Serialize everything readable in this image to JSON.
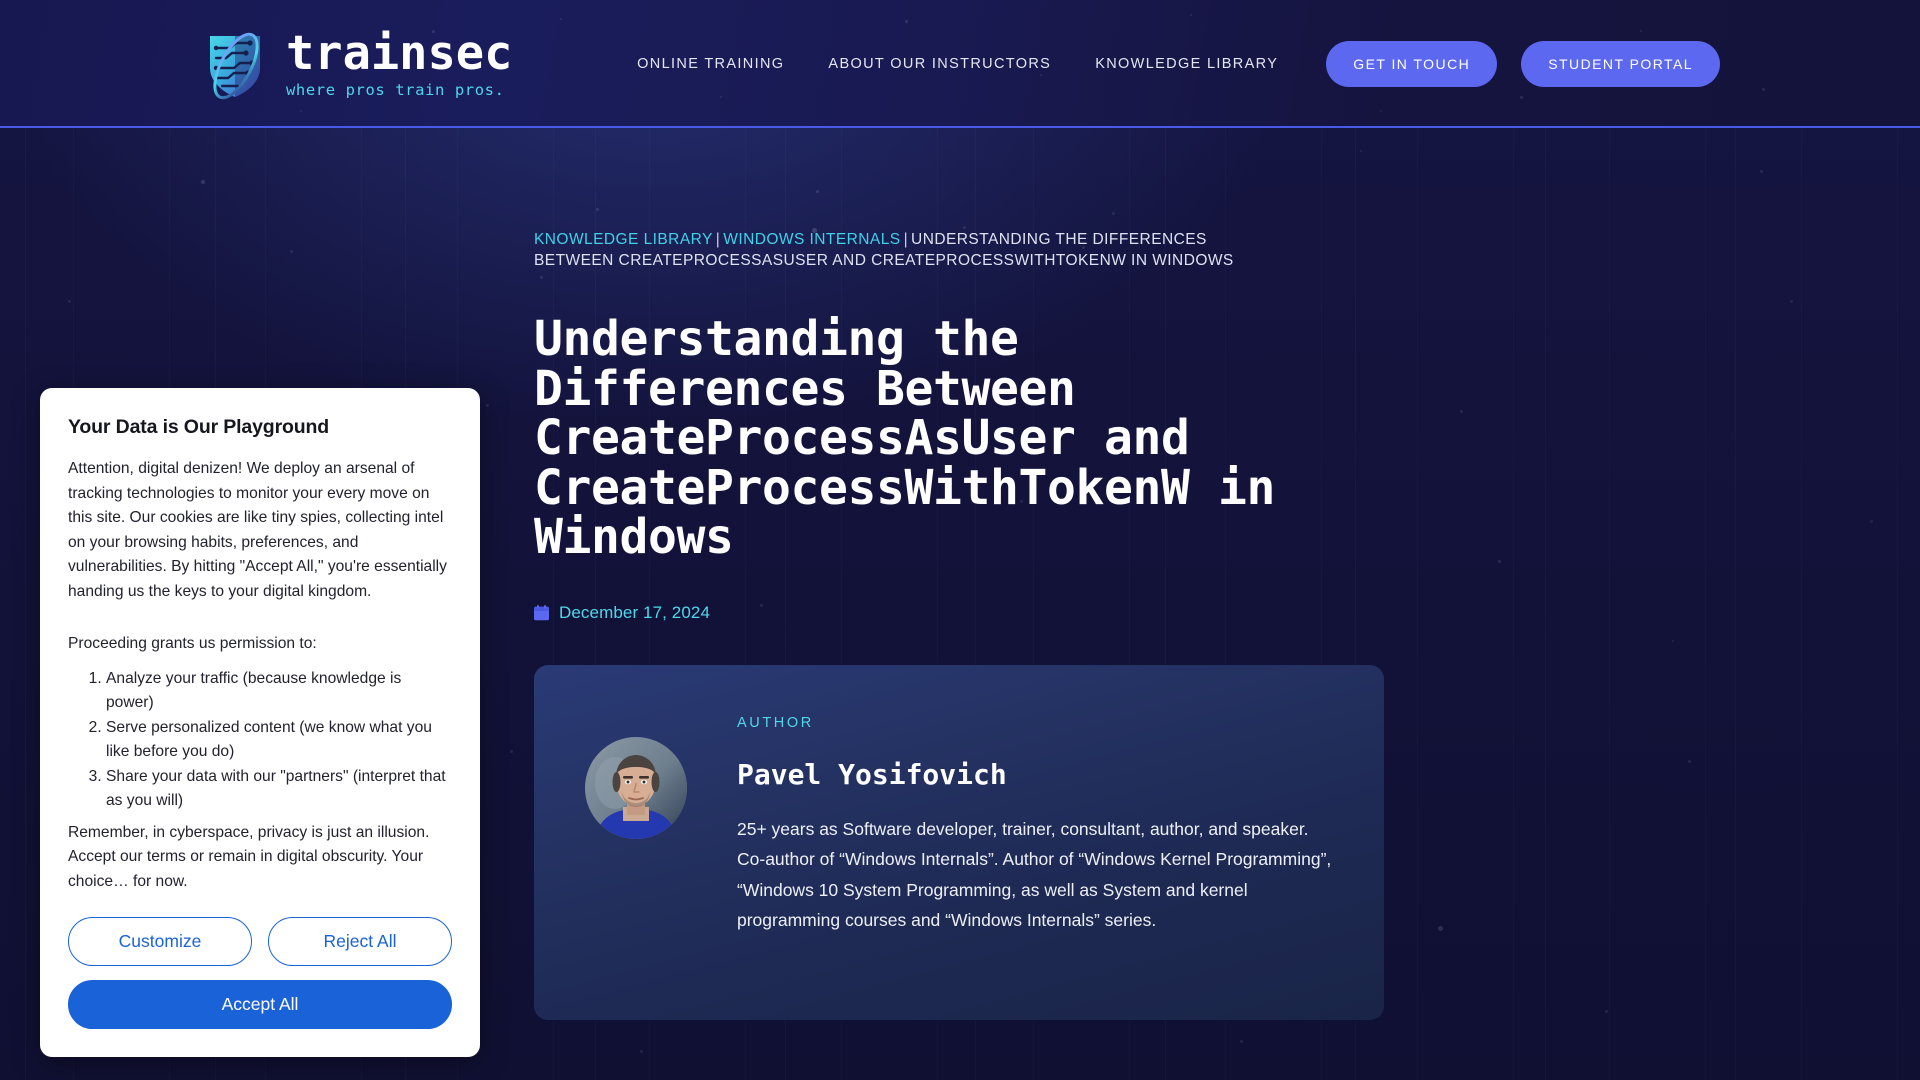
{
  "site": {
    "logo_word": "trainsec",
    "logo_tagline": "where pros train pros.",
    "logo_icon": "shield-circuit-logo"
  },
  "header": {
    "nav_links": [
      {
        "label": "ONLINE TRAINING",
        "name": "nav-online-training"
      },
      {
        "label": "ABOUT OUR INSTRUCTORS",
        "name": "nav-about-our-instructors"
      },
      {
        "label": "KNOWLEDGE LIBRARY",
        "name": "nav-knowledge-library"
      }
    ],
    "cta_primary": "GET IN TOUCH",
    "cta_secondary": "STUDENT PORTAL",
    "accent_color": "#5b68ef",
    "underline_color": "#4a5ae8",
    "background_color": "#18195a"
  },
  "breadcrumb": {
    "link1": "KNOWLEDGE LIBRARY",
    "separator": "|",
    "link2": "WINDOWS INTERNALS",
    "current": "UNDERSTANDING THE DIFFERENCES BETWEEN CREATEPROCESSASUSER AND CREATEPROCESSWITHTOKENW IN WINDOWS",
    "link_color": "#3fd2e8"
  },
  "article": {
    "title": "Understanding the Differences Between CreateProcessAsUser and CreateProcessWithTokenW in Windows",
    "date": "December 17, 2024",
    "date_icon": "calendar-icon",
    "date_color": "#4fd8ea"
  },
  "author_card": {
    "label": "AUTHOR",
    "name": "Pavel Yosifovich",
    "avatar_icon": "author-portrait",
    "bio": "25+ years as Software developer, trainer, consultant, author, and speaker. Co-author of “Windows Internals”. Author of “Windows Kernel Programming”, “Windows 10 System Programming, as well as System and kernel programming courses and “Windows Internals” series."
  },
  "cookie_consent": {
    "heading": "Your Data is Our Playground",
    "intro": "Attention, digital denizen! We deploy an arsenal of tracking technologies to monitor your every move on this site. Our cookies are like tiny spies, collecting intel on your browsing habits, preferences, and vulnerabilities. By hitting \"Accept All,\" you're essentially handing us the keys to your digital kingdom.",
    "proceed_label": "Proceeding grants us permission to:",
    "permissions": [
      "Analyze your traffic (because knowledge is power)",
      "Serve personalized content (we know what you like before you do)",
      "Share your data with our \"partners\" (interpret that as you will)"
    ],
    "outro": "Remember, in cyberspace, privacy is just an illusion. Accept our terms or remain in digital obscurity. Your choice… for now.",
    "customize_label": "Customize",
    "reject_label": "Reject All",
    "accept_label": "Accept All",
    "primary_color": "#1a62d8"
  }
}
